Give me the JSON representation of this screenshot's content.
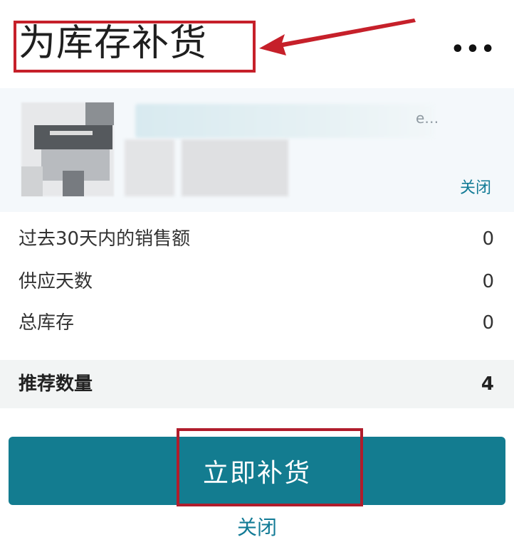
{
  "header": {
    "title": "为库存补货",
    "more_icon": "more-horizontal-icon",
    "more_glyph": "•••"
  },
  "product": {
    "name_tail": "e…",
    "close_label": "关闭"
  },
  "stats": [
    {
      "label": "过去30天内的销售额",
      "value": "0"
    },
    {
      "label": "供应天数",
      "value": "0"
    },
    {
      "label": "总库存",
      "value": "0"
    }
  ],
  "recommend": {
    "label": "推荐数量",
    "value": "4"
  },
  "actions": {
    "restock_label": "立即补货",
    "close_label": "关闭"
  },
  "colors": {
    "accent": "#137c90",
    "link": "#127b96",
    "annotation": "#c6202a"
  }
}
